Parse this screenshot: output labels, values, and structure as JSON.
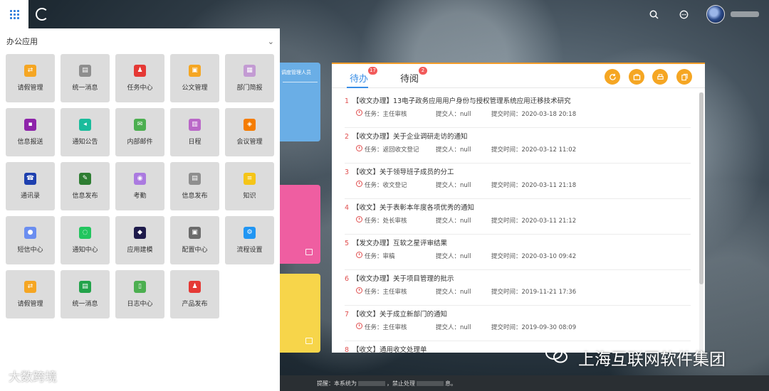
{
  "topbar": {
    "username": ""
  },
  "app_panel": {
    "title": "办公应用",
    "apps": [
      {
        "label": "请假管理",
        "icon": "share-icon",
        "color": "#f5a623"
      },
      {
        "label": "统一消息",
        "icon": "message-icon",
        "color": "#8e8e8e"
      },
      {
        "label": "任务中心",
        "icon": "user-task-icon",
        "color": "#e53935"
      },
      {
        "label": "公文管理",
        "icon": "briefcase-icon",
        "color": "#f5a623"
      },
      {
        "label": "部门简报",
        "icon": "report-icon",
        "color": "#c39bd3"
      },
      {
        "label": "信息报送",
        "icon": "submit-icon",
        "color": "#8e24aa"
      },
      {
        "label": "通知公告",
        "icon": "speaker-icon",
        "color": "#1abc9c"
      },
      {
        "label": "内部邮件",
        "icon": "mail-icon",
        "color": "#4caf50"
      },
      {
        "label": "日程",
        "icon": "calendar-icon",
        "color": "#ba68c8"
      },
      {
        "label": "会议管理",
        "icon": "meeting-icon",
        "color": "#f57c00"
      },
      {
        "label": "通讯录",
        "icon": "phone-book-icon",
        "color": "#1e40af"
      },
      {
        "label": "信息发布",
        "icon": "edit-icon",
        "color": "#2e7d32"
      },
      {
        "label": "考勤",
        "icon": "location-icon",
        "color": "#ab7ae0"
      },
      {
        "label": "信息发布",
        "icon": "document-icon",
        "color": "#8e8e8e"
      },
      {
        "label": "知识",
        "icon": "database-icon",
        "color": "#f5c518"
      },
      {
        "label": "短信中心",
        "icon": "chat-icon",
        "color": "#6b8ef0"
      },
      {
        "label": "通知中心",
        "icon": "bubble-icon",
        "color": "#22c55e"
      },
      {
        "label": "应用建模",
        "icon": "cube-icon",
        "color": "#1e1b4b"
      },
      {
        "label": "配置中心",
        "icon": "config-icon",
        "color": "#6b6b6b"
      },
      {
        "label": "流程设置",
        "icon": "flow-settings-icon",
        "color": "#2196f3"
      },
      {
        "label": "请假管理",
        "icon": "share-icon",
        "color": "#f5a623"
      },
      {
        "label": "统一消息",
        "icon": "message-icon",
        "color": "#22a34a"
      },
      {
        "label": "日志中心",
        "icon": "log-icon",
        "color": "#4caf50"
      },
      {
        "label": "产品发布",
        "icon": "user-publish-icon",
        "color": "#e53935"
      }
    ]
  },
  "side_cards": {
    "blue_title": "调度管理人员"
  },
  "task_panel": {
    "tabs": [
      {
        "label": "待办",
        "count": "17"
      },
      {
        "label": "待阅",
        "count": "2"
      }
    ],
    "task_label": "任务：",
    "submitter_label": "提交人：",
    "time_label": "提交时间：",
    "tasks": [
      {
        "num": "1",
        "title": "【收文办理】13电子政务应用用户身份与授权管理系统应用迁移技术研究",
        "task": "主任审核",
        "submitter": "null",
        "time": "2020-03-18 20:18"
      },
      {
        "num": "2",
        "title": "【收文办理】关于企业调研走访的通知",
        "task": "返回收文登记",
        "submitter": "null",
        "time": "2020-03-12 11:02"
      },
      {
        "num": "3",
        "title": "【收文】关于领导班子成员的分工",
        "task": "收文登记",
        "submitter": "null",
        "time": "2020-03-11 21:18"
      },
      {
        "num": "4",
        "title": "【收文】关于表彰本年度各项优秀的通知",
        "task": "处长审核",
        "submitter": "null",
        "time": "2020-03-11 21:12"
      },
      {
        "num": "5",
        "title": "【发文办理】互软之星评审结果",
        "task": "审稿",
        "submitter": "null",
        "time": "2020-03-10 09:42"
      },
      {
        "num": "6",
        "title": "【收文办理】关于项目管理的批示",
        "task": "主任审核",
        "submitter": "null",
        "time": "2019-11-21 17:36"
      },
      {
        "num": "7",
        "title": "【收文】关于成立新部门的通知",
        "task": "主任审核",
        "submitter": "null",
        "time": "2019-09-30 08:09"
      },
      {
        "num": "8",
        "title": "【收文】通用收文处理单",
        "task": "",
        "submitter": "",
        "time": ""
      }
    ]
  },
  "statusbar": {
    "prefix": "提醒：本系统为",
    "middle": "，禁止处理",
    "suffix": "息。"
  },
  "watermarks": {
    "left": "大数跨境",
    "right": "上海互联网软件集团"
  }
}
